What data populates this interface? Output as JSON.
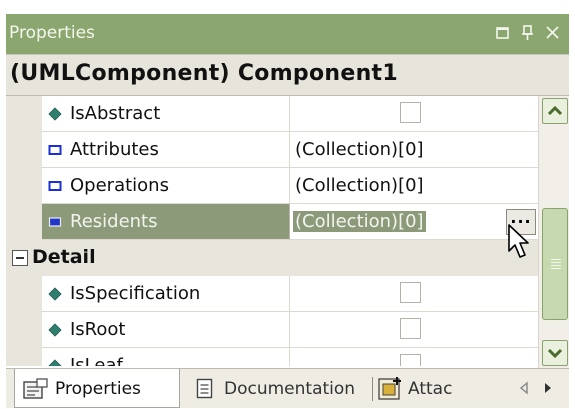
{
  "window": {
    "title": "Properties",
    "buttons": [
      "restore-icon",
      "pin-icon",
      "close-icon"
    ]
  },
  "object_header": "(UMLComponent) Component1",
  "rows": [
    {
      "kind": "property",
      "icon": "diamond-icon",
      "name": "IsAbstract",
      "value_type": "checkbox",
      "checked": false
    },
    {
      "kind": "property",
      "icon": "collection-icon",
      "name": "Attributes",
      "value": "(Collection)[0]"
    },
    {
      "kind": "property",
      "icon": "collection-icon",
      "name": "Operations",
      "value": "(Collection)[0]"
    },
    {
      "kind": "property",
      "icon": "collection-icon",
      "name": "Residents",
      "value": "(Collection)[0]",
      "selected": true,
      "button_label": "..."
    },
    {
      "kind": "category",
      "name": "Detail",
      "expanded": true
    },
    {
      "kind": "property",
      "icon": "diamond-icon",
      "name": "IsSpecification",
      "value_type": "checkbox",
      "checked": false
    },
    {
      "kind": "property",
      "icon": "diamond-icon",
      "name": "IsRoot",
      "value_type": "checkbox",
      "checked": false
    },
    {
      "kind": "property",
      "icon": "diamond-icon",
      "name": "IsLeaf",
      "value_type": "checkbox",
      "checked": false
    }
  ],
  "tabs": [
    {
      "label": "Properties",
      "icon": "properties-tab-icon",
      "active": true
    },
    {
      "label": "Documentation",
      "icon": "document-icon",
      "active": false
    },
    {
      "label": "Attac",
      "icon": "attachments-icon",
      "active": false
    }
  ],
  "colors": {
    "titlebar": "#8ba66e",
    "selection": "#8c9a7a",
    "scrollbar_accent": "#c7d9ae",
    "property_icon": "#2f7f6f",
    "collection_icon": "#1a2fd6"
  }
}
